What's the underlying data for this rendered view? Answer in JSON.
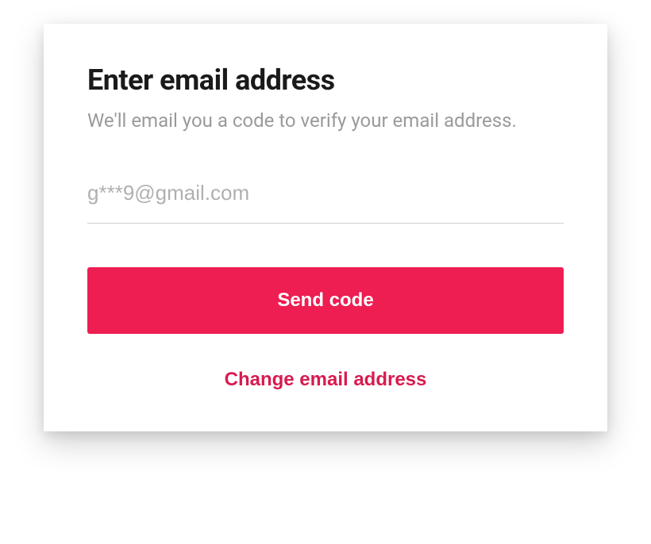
{
  "header": {
    "title": "Enter email address",
    "subtitle": "We'll email you a code to verify your email address."
  },
  "form": {
    "email_placeholder": "g***9@gmail.com",
    "send_button_label": "Send code",
    "change_link_label": "Change email address"
  }
}
